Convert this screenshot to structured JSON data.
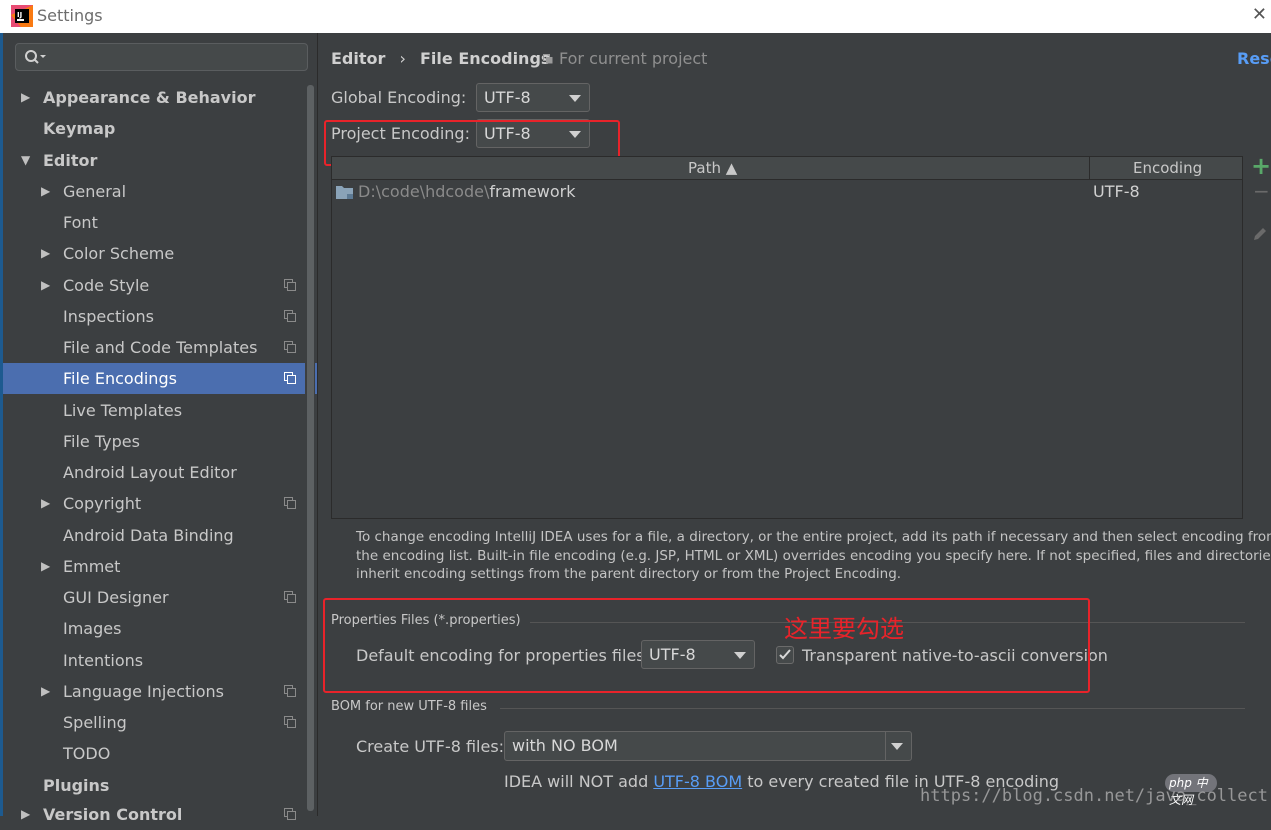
{
  "window": {
    "title": "Settings"
  },
  "sidebar": {
    "items": [
      {
        "label": "Appearance & Behavior"
      },
      {
        "label": "Keymap"
      },
      {
        "label": "Editor"
      },
      {
        "label": "General"
      },
      {
        "label": "Font"
      },
      {
        "label": "Color Scheme"
      },
      {
        "label": "Code Style"
      },
      {
        "label": "Inspections"
      },
      {
        "label": "File and Code Templates"
      },
      {
        "label": "File Encodings"
      },
      {
        "label": "Live Templates"
      },
      {
        "label": "File Types"
      },
      {
        "label": "Android Layout Editor"
      },
      {
        "label": "Copyright"
      },
      {
        "label": "Android Data Binding"
      },
      {
        "label": "Emmet"
      },
      {
        "label": "GUI Designer"
      },
      {
        "label": "Images"
      },
      {
        "label": "Intentions"
      },
      {
        "label": "Language Injections"
      },
      {
        "label": "Spelling"
      },
      {
        "label": "TODO"
      },
      {
        "label": "Plugins"
      },
      {
        "label": "Version Control"
      }
    ]
  },
  "header": {
    "crumb_parent": "Editor",
    "crumb_separator": "›",
    "crumb_current": "File Encodings",
    "scope": "For current project",
    "reset": "Rese"
  },
  "encodings": {
    "global_label": "Global Encoding:",
    "global_value": "UTF-8",
    "project_label": "Project Encoding:",
    "project_value": "UTF-8"
  },
  "table": {
    "col_path": "Path ▲",
    "col_encoding": "Encoding",
    "rows": [
      {
        "path_prefix": "D:\\code\\hdcode\\",
        "path_name": "framework",
        "encoding": "UTF-8"
      }
    ]
  },
  "toolbar": {
    "add": "+",
    "remove": "−"
  },
  "help_text": [
    "To change encoding IntelliJ IDEA uses for a file, a directory, or the entire project, add its path if necessary and then select encoding from",
    "the encoding list. Built-in file encoding (e.g. JSP, HTML or XML) overrides encoding you specify here. If not specified, files and directories",
    "inherit encoding settings from the parent directory or from the Project Encoding."
  ],
  "properties": {
    "section_title": "Properties Files (*.properties)",
    "default_label": "Default encoding for properties files:",
    "default_value": "UTF-8",
    "transparent_label": "Transparent native-to-ascii conversion",
    "transparent_checked": true,
    "annotation": "这里要勾选"
  },
  "bom": {
    "section_title": "BOM for new UTF-8 files",
    "create_label": "Create UTF-8 files:",
    "create_value": "with NO BOM",
    "info_prefix": "IDEA will NOT add ",
    "info_link": "UTF-8 BOM",
    "info_suffix": " to every created file in UTF-8 encoding"
  },
  "watermark": {
    "url": "https://blog.csdn.net/java_collect",
    "logo": "php 中文网"
  },
  "colors": {
    "selection": "#4b6eaf",
    "highlight": "#e8232a",
    "link": "#589df6",
    "add": "#59a869"
  }
}
